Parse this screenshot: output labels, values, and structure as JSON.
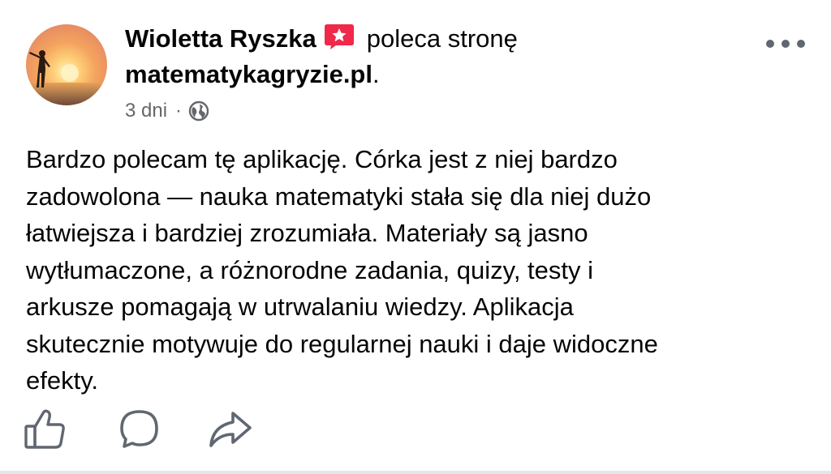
{
  "post": {
    "author": "Wioletta Ryszka",
    "action_text": "poleca stronę",
    "page_name": "matematykagryzie.pl",
    "page_suffix": ".",
    "timestamp": "3 dni",
    "separator": "·",
    "privacy_icon": "globe-icon",
    "badge_icon": "recommend-star-icon",
    "more_icon": "more-options-icon",
    "body": "Bardzo polecam tę aplikację. Córka jest z niej bardzo\nzadowolona — nauka matematyki stała się dla niej dużo\nłatwiejsza i bardziej zrozumiała. Materiały są jasno\nwytłumaczone, a różnorodne zadania, quizy, testy i\narkusze pomagają w utrwalaniu wiedzy. Aplikacja\nskutecznie motywuje do regularnej nauki i daje widoczne\nefekty."
  },
  "actions": [
    {
      "icon": "like-icon"
    },
    {
      "icon": "comment-icon"
    },
    {
      "icon": "share-icon"
    }
  ],
  "colors": {
    "text": "#050505",
    "secondary_text": "#65676b",
    "badge": "#f02849",
    "icon_gray": "#606770"
  }
}
